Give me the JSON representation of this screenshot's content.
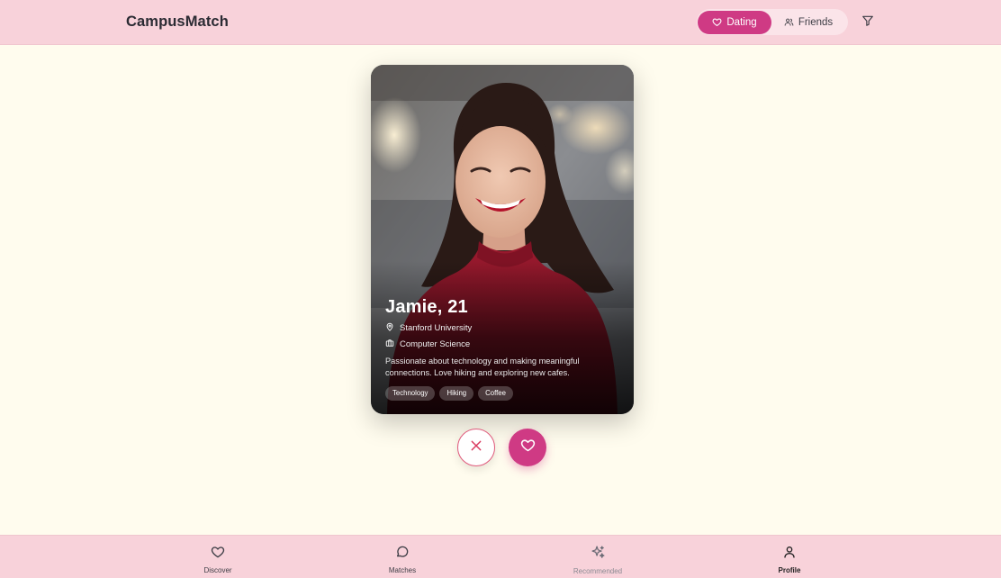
{
  "app": {
    "title": "CampusMatch"
  },
  "header": {
    "modes": [
      {
        "label": "Dating",
        "icon": "heart-icon",
        "active": true
      },
      {
        "label": "Friends",
        "icon": "users-icon",
        "active": false
      }
    ],
    "filter_icon": "filter-icon"
  },
  "profile": {
    "name_age": "Jamie, 21",
    "university": "Stanford University",
    "major": "Computer Science",
    "bio": "Passionate about technology and making meaningful connections. Love hiking and exploring new cafes.",
    "tags": [
      "Technology",
      "Hiking",
      "Coffee"
    ]
  },
  "actions": {
    "pass_icon": "close-icon",
    "like_icon": "heart-icon"
  },
  "nav": {
    "items": [
      {
        "label": "Discover",
        "icon": "heart-icon"
      },
      {
        "label": "Matches",
        "icon": "chat-icon"
      },
      {
        "label": "Recommended",
        "icon": "sparkles-icon"
      },
      {
        "label": "Profile",
        "icon": "user-icon"
      }
    ]
  },
  "colors": {
    "accent": "#cf3a84",
    "header_bg": "#f8d2da",
    "page_bg": "#fffcee",
    "pass_border": "#e05a7c"
  }
}
